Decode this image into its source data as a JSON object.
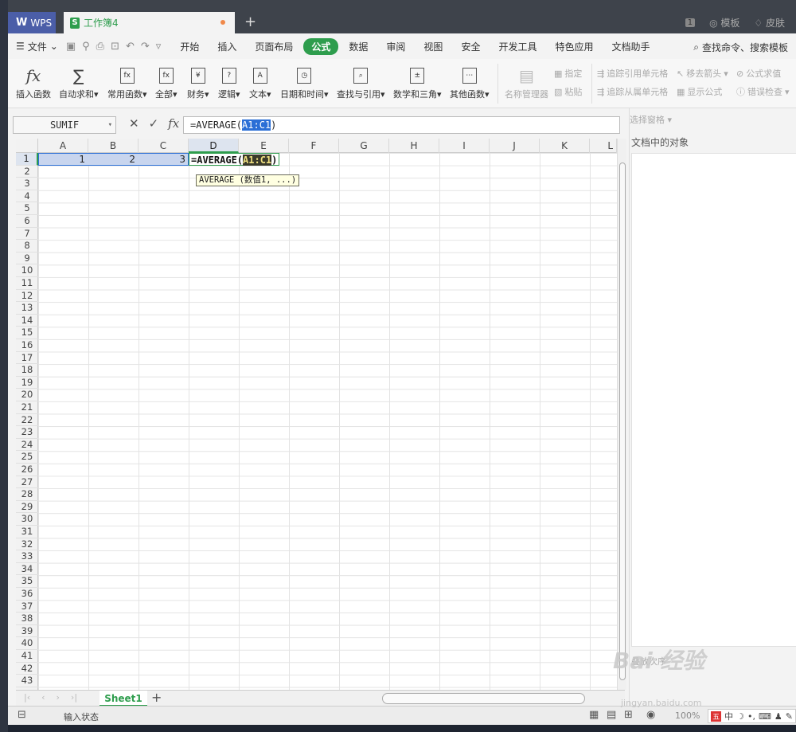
{
  "titlebar": {
    "app_tab": "WPS",
    "doc_tab": "工作簿4",
    "page_badge": "1",
    "template_label": "模板",
    "skin_label": "皮肤"
  },
  "menubar": {
    "file_label": "文件",
    "tabs": [
      "开始",
      "插入",
      "页面布局",
      "公式",
      "数据",
      "审阅",
      "视图",
      "安全",
      "开发工具",
      "特色应用",
      "文档助手"
    ],
    "active_tab": "公式",
    "search_label": "查找命令、搜索模板"
  },
  "ribbon": {
    "buttons": [
      {
        "label": "插入函数",
        "icon": "fx-icon"
      },
      {
        "label": "自动求和",
        "icon": "sigma-icon"
      },
      {
        "label": "常用函数",
        "icon": "common-func-icon"
      },
      {
        "label": "全部",
        "icon": "all-func-icon"
      },
      {
        "label": "财务",
        "icon": "finance-icon"
      },
      {
        "label": "逻辑",
        "icon": "logic-icon"
      },
      {
        "label": "文本",
        "icon": "text-icon"
      },
      {
        "label": "日期和时间",
        "icon": "clock-icon"
      },
      {
        "label": "查找与引用",
        "icon": "lookup-icon"
      },
      {
        "label": "数学和三角",
        "icon": "math-icon"
      },
      {
        "label": "其他函数",
        "icon": "more-func-icon"
      }
    ],
    "name_manager": "名称管理器",
    "specify": "指定",
    "paste": "粘贴",
    "trace_precedents": "追踪引用单元格",
    "trace_dependents": "追踪从属单元格",
    "remove_arrows": "移去箭头",
    "show_formula": "显示公式",
    "formula_eval": "公式求值",
    "error_check": "错误检查"
  },
  "formula_bar": {
    "name_box": "SUMIF",
    "formula_prefix": "=AVERAGE(",
    "formula_ref": "A1:C1",
    "formula_suffix": ")"
  },
  "grid": {
    "columns": [
      "A",
      "B",
      "C",
      "D",
      "E",
      "F",
      "G",
      "H",
      "I",
      "J",
      "K",
      "L"
    ],
    "rows": [
      "1",
      "2",
      "3",
      "4",
      "5",
      "6",
      "7",
      "8",
      "9",
      "10",
      "11",
      "12",
      "13",
      "14",
      "15",
      "16",
      "17",
      "18",
      "19",
      "20",
      "21",
      "22",
      "23",
      "24",
      "25",
      "26",
      "27",
      "28",
      "29",
      "30",
      "31",
      "32",
      "33",
      "34",
      "35",
      "36",
      "37",
      "38",
      "39",
      "40",
      "41",
      "42",
      "43"
    ],
    "cells": {
      "A1": "1",
      "B1": "2",
      "C1": "3"
    },
    "edit_prefix": "=AVERAGE(",
    "edit_ref": "A1:C1",
    "edit_suffix": ")",
    "tooltip": "AVERAGE (数值1, ...)"
  },
  "sheets": {
    "active": "Sheet1"
  },
  "status": {
    "mode": "输入状态",
    "zoom": "100%"
  },
  "pane": {
    "header": "选择窗格",
    "title": "文档中的对象",
    "order_label": "叠放次序"
  },
  "watermark": {
    "logo": "Bai 经验",
    "url": "jingyan.baidu.com"
  }
}
